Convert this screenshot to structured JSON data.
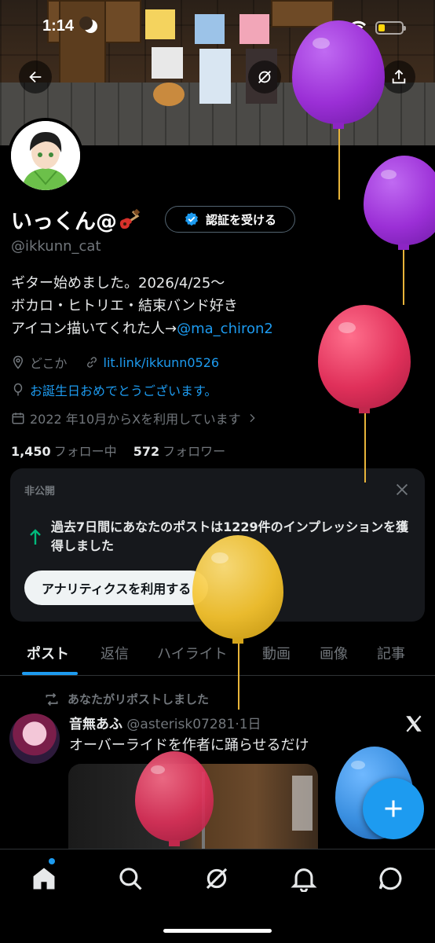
{
  "status_bar": {
    "time": "1:14"
  },
  "profile": {
    "display_name": "いっくん@",
    "verify_button": "認証を受ける",
    "handle": "@ikkunn_cat",
    "bio_line1": "ギター始めました。2026/4/25～",
    "bio_line2": "ボカロ・ヒトリエ・結束バンド好き",
    "bio_line3_prefix": "アイコン描いてくれた人→",
    "bio_line3_mention": "@ma_chiron2",
    "location": "どこか",
    "website": "lit.link/ikkunn0526",
    "birthday": "お誕生日おめでとうございます。",
    "joined": "2022 年10月からXを利用しています",
    "following_count": "1,450",
    "following_label": "フォロー中",
    "followers_count": "572",
    "followers_label": "フォロワー"
  },
  "private_card": {
    "label": "非公開",
    "message": "過去7日間にあなたのポストは1229件のインプレッションを獲得しました",
    "cta": "アナリティクスを利用する"
  },
  "tabs": [
    "ポスト",
    "返信",
    "ハイライト",
    "動画",
    "画像",
    "記事"
  ],
  "post": {
    "repost_label": "あなたがリポストしました",
    "author_name": "音無あふ",
    "author_handle": "@asterisk07281",
    "time": "·1日",
    "text": "オーバーライドを作者に踊らせるだけ"
  },
  "colors": {
    "accent": "#1d9bf0",
    "balloon_purple": "#9b2fd6",
    "balloon_red": "#e0305a",
    "balloon_yellow": "#f2c12e",
    "balloon_blue": "#3a8fe0"
  },
  "icons": {
    "back": "arrow-left-icon",
    "grok": "grok-icon",
    "search": "search-icon",
    "edit": "pencil-icon",
    "share": "share-icon",
    "location": "location-pin-icon",
    "link": "link-icon",
    "birthday": "balloon-icon",
    "calendar": "calendar-icon",
    "home": "home-icon",
    "notifications": "bell-icon",
    "messages": "message-icon"
  }
}
